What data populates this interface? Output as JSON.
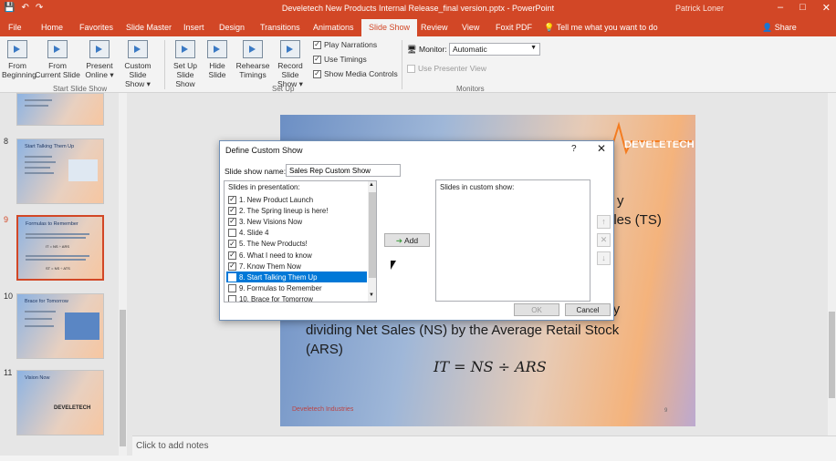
{
  "titlebar": {
    "title": "Develetech New Products Internal Release_final version.pptx - PowerPoint",
    "user": "Patrick Loner",
    "qat_icons": [
      "save-icon",
      "undo-icon",
      "redo-icon"
    ]
  },
  "tabs": [
    "File",
    "Home",
    "Favorites",
    "Slide Master",
    "Insert",
    "Design",
    "Transitions",
    "Animations",
    "Slide Show",
    "Review",
    "View",
    "Foxit PDF"
  ],
  "active_tab": "Slide Show",
  "tellme": "Tell me what you want to do",
  "share": "Share",
  "ribbon": {
    "buttons": [
      {
        "label1": "From",
        "label2": "Beginning"
      },
      {
        "label1": "From",
        "label2": "Current Slide"
      },
      {
        "label1": "Present",
        "label2": "Online ▾"
      },
      {
        "label1": "Custom Slide",
        "label2": "Show ▾"
      },
      {
        "label1": "Set Up",
        "label2": "Slide Show"
      },
      {
        "label1": "Hide",
        "label2": "Slide"
      },
      {
        "label1": "Rehearse",
        "label2": "Timings"
      },
      {
        "label1": "Record Slide",
        "label2": "Show ▾"
      }
    ],
    "checks": [
      "Play Narrations",
      "Use Timings",
      "Show Media Controls"
    ],
    "groups": [
      "Start Slide Show",
      "Set Up",
      "Monitors"
    ],
    "monitor_label": "Monitor:",
    "monitor_value": "Automatic",
    "presenter_view": "Use Presenter View"
  },
  "thumbs": [
    {
      "num": "",
      "title": ""
    },
    {
      "num": "8",
      "title": "Start Talking Them Up"
    },
    {
      "num": "9",
      "title": "Formulas to Remember",
      "formula1": "IT = NS ÷ ARS",
      "formula2": "ST = NS ÷ ATS"
    },
    {
      "num": "10",
      "title": "Brace for Tomorrow"
    },
    {
      "num": "11",
      "title": "Vision Now",
      "logo": "DEVELETECH"
    }
  ],
  "slide": {
    "logo": "DEVELETECH",
    "partial1": "y",
    "partial2": "ales (TS)",
    "partial3": "t by",
    "body": "dividing Net Sales (NS) by the Average Retail Stock (ARS)",
    "formula": "IT = NS ÷ ARS",
    "footer": "Develetech Industries",
    "page": "9"
  },
  "notes": "Click to add notes",
  "dialog": {
    "title": "Define Custom Show",
    "help": "?",
    "close": "✕",
    "name_label": "Slide show name:",
    "name_value": "Sales Rep Custom Show",
    "list_header": "Slides in presentation:",
    "slides": [
      {
        "label": "1. New Product Launch",
        "checked": true
      },
      {
        "label": "2. The Spring lineup is here!",
        "checked": true
      },
      {
        "label": "3. New Visions Now",
        "checked": true
      },
      {
        "label": "4. Slide 4",
        "checked": false
      },
      {
        "label": "5. The New Products!",
        "checked": true
      },
      {
        "label": "6. What I need to know",
        "checked": true
      },
      {
        "label": "7. Know Them Now",
        "checked": true
      },
      {
        "label": "8. Start Talking Them Up",
        "checked": true
      },
      {
        "label": "9. Formulas to Remember",
        "checked": false
      },
      {
        "label": "10. Brace for Tomorrow",
        "checked": false
      }
    ],
    "selected_index": 7,
    "add": "Add",
    "custom_header": "Slides in custom show:",
    "ok": "OK",
    "cancel": "Cancel"
  }
}
